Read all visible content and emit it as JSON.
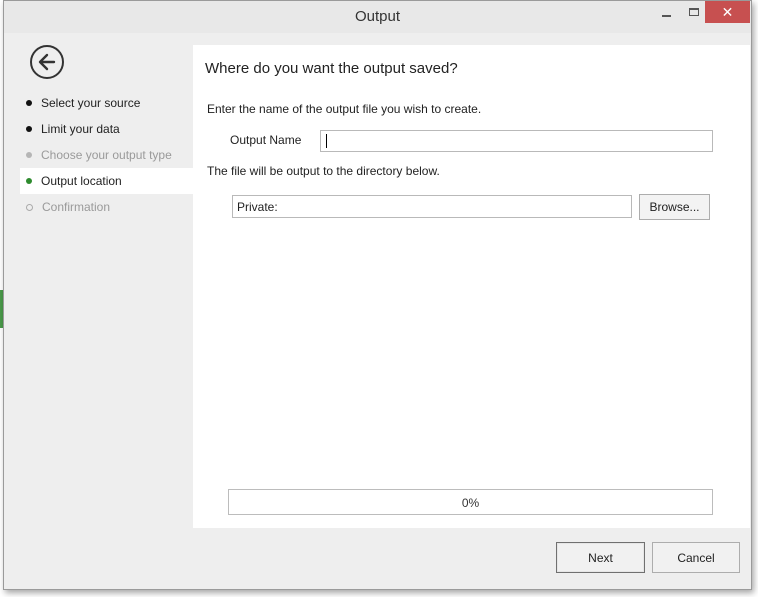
{
  "window": {
    "title": "Output",
    "minimize_icon": "minimize-icon",
    "maximize_icon": "maximize-icon",
    "close_icon": "close-icon",
    "close_glyph": "✕",
    "close_color": "#c75050"
  },
  "sidebar": {
    "back_icon": "back-arrow-icon",
    "steps": [
      {
        "label": "Select your source",
        "state": "done"
      },
      {
        "label": "Limit your data",
        "state": "done"
      },
      {
        "label": "Choose your output type",
        "state": "disabled"
      },
      {
        "label": "Output location",
        "state": "active"
      },
      {
        "label": "Confirmation",
        "state": "future"
      }
    ],
    "active_color": "#2e8b2e"
  },
  "main": {
    "heading": "Where do you want the output saved?",
    "instruction_name": "Enter the name of the output file you wish to create.",
    "output_name_label": "Output Name",
    "output_name_value": "",
    "instruction_dir": "The file will be output to the directory below.",
    "directory_value": "Private:",
    "browse_label": "Browse...",
    "progress": {
      "value": 0,
      "text": "0%"
    }
  },
  "footer": {
    "next_label": "Next",
    "cancel_label": "Cancel"
  }
}
